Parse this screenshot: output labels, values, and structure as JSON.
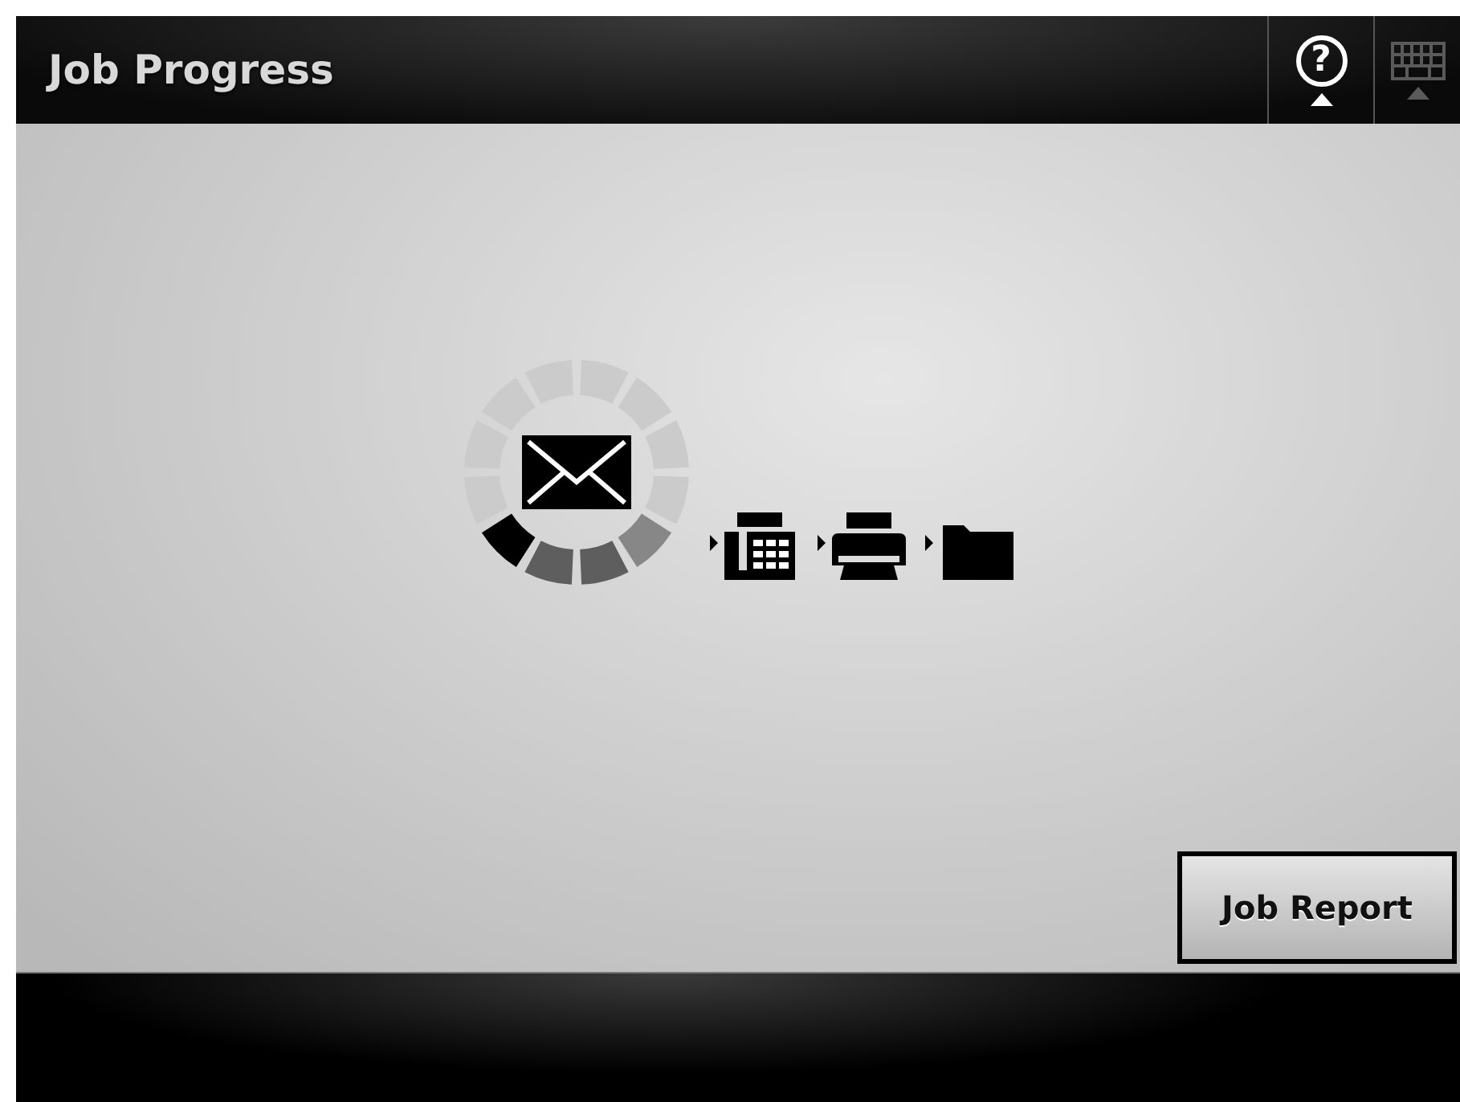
{
  "header": {
    "title": "Job Progress",
    "help_button": {
      "label": "?",
      "disabled": false
    },
    "keyboard_button": {
      "disabled": true
    }
  },
  "actions": [
    {
      "label": "Job Report"
    }
  ]
}
